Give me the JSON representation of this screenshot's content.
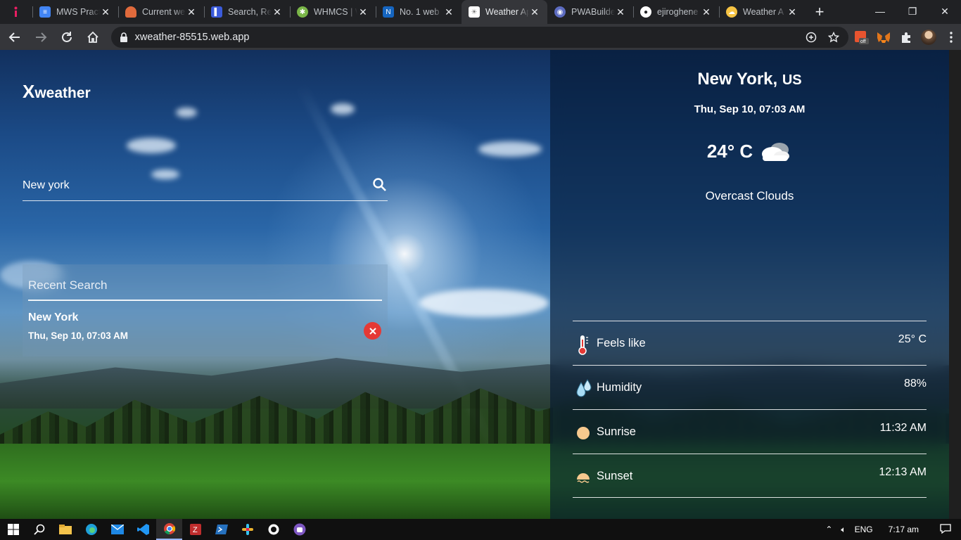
{
  "browser": {
    "tabs": [
      {
        "title": "MWS Practi",
        "favicon": "docs-icon",
        "color": "#4285f4"
      },
      {
        "title": "Current we",
        "favicon": "cloud-icon",
        "color": "#e06a3c"
      },
      {
        "title": "Search, Re",
        "favicon": "bookmark-icon",
        "color": "#3b5bdb"
      },
      {
        "title": "WHMCS | W",
        "favicon": "gear-icon",
        "color": "#7ab648"
      },
      {
        "title": "No. 1 web",
        "favicon": "n-icon",
        "color": "#1565c0"
      },
      {
        "title": "Weather Ap",
        "favicon": "sun-icon",
        "color": "#ffffff",
        "active": true
      },
      {
        "title": "PWABuilde",
        "favicon": "pwa-icon",
        "color": "#5c6bc0"
      },
      {
        "title": "ejiroghene",
        "favicon": "github-icon",
        "color": "#ffffff"
      },
      {
        "title": "Weather A",
        "favicon": "weather-icon",
        "color": "#f6c343"
      }
    ],
    "address": "xweather-85515.web.app"
  },
  "app": {
    "brand_initial": "X",
    "brand_rest": "weather",
    "search": {
      "value": "New york",
      "placeholder": ""
    },
    "recent": {
      "title": "Recent Search",
      "items": [
        {
          "city": "New York",
          "time": "Thu, Sep 10, 07:03 AM"
        }
      ]
    },
    "current": {
      "city": "New York,",
      "country": "US",
      "datetime": "Thu, Sep 10, 07:03 AM",
      "temp": "24° C",
      "description": "Overcast Clouds"
    },
    "stats": [
      {
        "label": "Feels like",
        "value": "25° C",
        "icon": "thermometer-icon"
      },
      {
        "label": "Humidity",
        "value": "88%",
        "icon": "water-drops-icon"
      },
      {
        "label": "Sunrise",
        "value": "11:32 AM",
        "icon": "sunrise-icon"
      },
      {
        "label": "Sunset",
        "value": "12:13 AM",
        "icon": "sunset-icon"
      }
    ]
  },
  "taskbar": {
    "language": "ENG",
    "time": "7:17 am"
  }
}
